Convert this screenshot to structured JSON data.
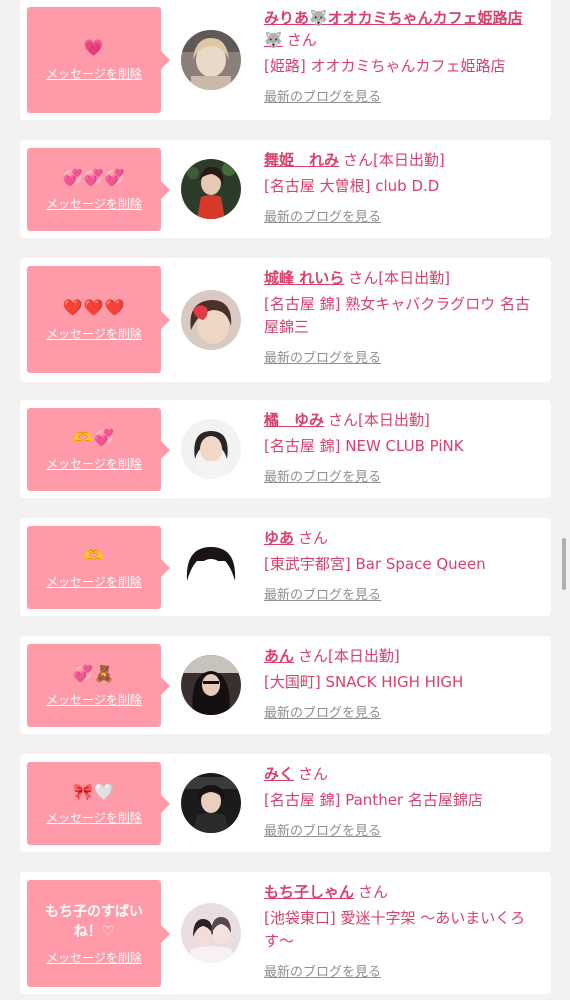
{
  "common": {
    "delete_label": "メッセージを削除",
    "blog_label": "最新のブログを見る",
    "honorific": "さん"
  },
  "colors": {
    "card_background": "#ffffff",
    "page_background": "#f2f2f2",
    "message_bubble": "#ff9aa9",
    "accent": "#d9406a",
    "link_gray": "#8f8f8f"
  },
  "entries": [
    {
      "message": "💗",
      "message_style": "emoji",
      "name": "みりあ🐺オオカミちゃんカフェ姫路店🐺",
      "badge": "",
      "shop": "[姫路] オオカミちゃんカフェ姫路店",
      "avatar_icon": "avatar-photo-icon"
    },
    {
      "message": "💞💞💞",
      "message_style": "emoji",
      "name": "舞姫　れみ",
      "badge": "[本日出勤]",
      "shop": "[名古屋 大曽根] club D.D",
      "avatar_icon": "avatar-photo-icon"
    },
    {
      "message": "❤️❤️❤️",
      "message_style": "emoji",
      "name": "城峰 れいら",
      "badge": "[本日出勤]",
      "shop": "[名古屋 錦] 熟女キャバクラグロウ 名古屋錦三",
      "avatar_icon": "avatar-photo-icon"
    },
    {
      "message": "🫶💞",
      "message_style": "emoji",
      "name": "橘　ゆみ",
      "badge": "[本日出勤]",
      "shop": "[名古屋 錦] NEW CLUB PiNK",
      "avatar_icon": "avatar-photo-icon"
    },
    {
      "message": "🫶",
      "message_style": "emoji",
      "name": "ゆあ",
      "badge": "",
      "shop": "[東武宇都宮] Bar Space Queen",
      "avatar_icon": "avatar-photo-icon"
    },
    {
      "message": "💞🧸",
      "message_style": "emoji",
      "name": "あん",
      "badge": "[本日出勤]",
      "shop": "[大国町] SNACK HIGH HIGH",
      "avatar_icon": "avatar-photo-icon"
    },
    {
      "message": "🎀🤍",
      "message_style": "emoji",
      "name": "みく",
      "badge": "",
      "shop": "[名古屋 錦] Panther 名古屋錦店",
      "avatar_icon": "avatar-photo-icon"
    },
    {
      "message": "もち子のすばいね！♡",
      "message_style": "text",
      "name": "もち子しゃん",
      "badge": "",
      "shop": "[池袋東口] 愛迷十字架 〜あいまいくろす〜",
      "avatar_icon": "avatar-photo-icon"
    }
  ]
}
